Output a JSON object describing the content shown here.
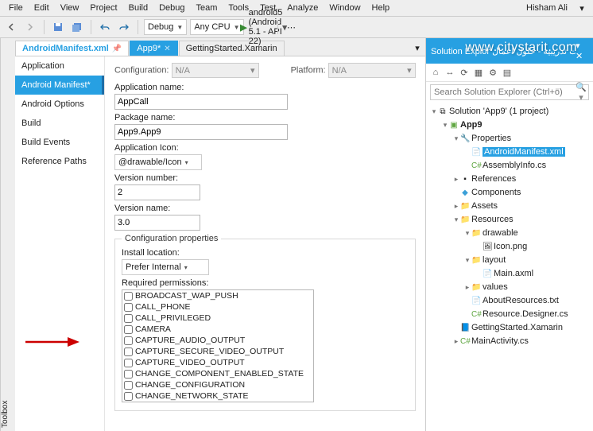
{
  "menu": {
    "items": [
      "File",
      "Edit",
      "View",
      "Project",
      "Build",
      "Debug",
      "Team",
      "Tools",
      "Test",
      "Analyze",
      "Window",
      "Help"
    ],
    "user": "Hisham Ali"
  },
  "toolbar": {
    "config": "Debug",
    "platform": "Any CPU",
    "run": "android5 (Android 5.1 - API 22)"
  },
  "tabs": [
    {
      "label": "AndroidManifest.xml",
      "active": true
    },
    {
      "label": "App9*",
      "edited": true
    },
    {
      "label": "GettingStarted.Xamarin"
    }
  ],
  "leftnav": [
    "Application",
    "Android Manifest*",
    "Android Options",
    "Build",
    "Build Events",
    "Reference Paths"
  ],
  "filters": {
    "configLbl": "Configuration:",
    "configVal": "N/A",
    "platLbl": "Platform:",
    "platVal": "N/A"
  },
  "form": {
    "appNameLbl": "Application name:",
    "appName": "AppCall",
    "pkgLbl": "Package name:",
    "pkg": "App9.App9",
    "iconLbl": "Application Icon:",
    "icon": "@drawable/Icon",
    "verNumLbl": "Version number:",
    "verNum": "2",
    "verNameLbl": "Version name:",
    "verName": "3.0",
    "confHeader": "Configuration properties",
    "installLbl": "Install location:",
    "install": "Prefer Internal",
    "reqPermLbl": "Required permissions:"
  },
  "permissions": [
    "BROADCAST_WAP_PUSH",
    "CALL_PHONE",
    "CALL_PRIVILEGED",
    "CAMERA",
    "CAPTURE_AUDIO_OUTPUT",
    "CAPTURE_SECURE_VIDEO_OUTPUT",
    "CAPTURE_VIDEO_OUTPUT",
    "CHANGE_COMPONENT_ENABLED_STATE",
    "CHANGE_CONFIGURATION",
    "CHANGE_NETWORK_STATE"
  ],
  "solution": {
    "title": "Solution Explor",
    "subtitle": "دورات تدريبية - حلول اعمال",
    "searchPh": "Search Solution Explorer (Ctrl+ö)",
    "root": "Solution 'App9' (1 project)",
    "project": "App9",
    "nodes": {
      "properties": "Properties",
      "manifest": "AndroidManifest.xml",
      "assembly": "AssemblyInfo.cs",
      "references": "References",
      "components": "Components",
      "assets": "Assets",
      "resources": "Resources",
      "drawable": "drawable",
      "iconpng": "Icon.png",
      "layout": "layout",
      "mainaxml": "Main.axml",
      "values": "values",
      "aboutres": "AboutResources.txt",
      "resdesigner": "Resource.Designer.cs",
      "getstarted": "GettingStarted.Xamarin",
      "mainact": "MainActivity.cs"
    }
  },
  "toolbox": "Toolbox",
  "watermark": "www.citystarit.com"
}
